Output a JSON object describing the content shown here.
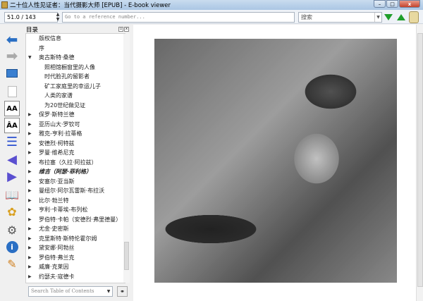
{
  "window": {
    "title": "二十位人性见证者：当代摄影大师 [EPUB] - E-book viewer",
    "minimize": "–",
    "maximize": "□",
    "close": "x"
  },
  "toolbar": {
    "page_position": "51.0 / 143",
    "reference_placeholder": "Go to a reference number...",
    "search_placeholder": "搜索"
  },
  "sidebar": {
    "icons": [
      "back-icon",
      "forward-icon",
      "view-icon",
      "copy-icon",
      "font-larger-icon",
      "font-smaller-icon",
      "toc-icon",
      "previous-page-icon",
      "next-page-icon",
      "reference-mode-icon",
      "theme-icon",
      "preferences-icon",
      "metadata-info-icon",
      "bookmark-icon"
    ]
  },
  "toc": {
    "title": "目录",
    "search_placeholder": "Search Table of Contents",
    "items": [
      {
        "label": "版权信息",
        "level": 0,
        "arrow": ""
      },
      {
        "label": "序",
        "level": 0,
        "arrow": ""
      },
      {
        "label": "奥古斯特·桑德",
        "level": 0,
        "arrow": "▼"
      },
      {
        "label": "照相馆橱窗里的人像",
        "level": 1,
        "arrow": ""
      },
      {
        "label": "时代脸孔的留影者",
        "level": 1,
        "arrow": ""
      },
      {
        "label": "矿工家庭里的幸运儿子",
        "level": 1,
        "arrow": ""
      },
      {
        "label": "人类的家谱",
        "level": 1,
        "arrow": ""
      },
      {
        "label": "为20世纪做见证",
        "level": 1,
        "arrow": ""
      },
      {
        "label": "保罗·斯特兰德",
        "level": 0,
        "arrow": "▶"
      },
      {
        "label": "亚历山大·罗钦可",
        "level": 0,
        "arrow": "▶"
      },
      {
        "label": "雅克-亨利·拉蒂格",
        "level": 0,
        "arrow": "▶"
      },
      {
        "label": "安德烈·柯特兹",
        "level": 0,
        "arrow": "▶"
      },
      {
        "label": "罗曼·维希尼克",
        "level": 0,
        "arrow": "▶"
      },
      {
        "label": "布拉塞（久拉·阿拉兹）",
        "level": 0,
        "arrow": "▶"
      },
      {
        "label": "维吉（阿瑟·菲利格）",
        "level": 0,
        "arrow": "▶",
        "current": true
      },
      {
        "label": "安塞尔·亚当斯",
        "level": 0,
        "arrow": "▶"
      },
      {
        "label": "曼纽尔·阿尔瓦雷斯·布拉沃",
        "level": 0,
        "arrow": "▶"
      },
      {
        "label": "比尔·勃兰特",
        "level": 0,
        "arrow": "▶"
      },
      {
        "label": "亨利·卡蒂埃-布列松",
        "level": 0,
        "arrow": "▶"
      },
      {
        "label": "罗伯特·卡帕（安德烈·弗里德曼）",
        "level": 0,
        "arrow": "▶"
      },
      {
        "label": "尤金·史密斯",
        "level": 0,
        "arrow": "▶"
      },
      {
        "label": "克里斯特·斯特伦霍尔姆",
        "level": 0,
        "arrow": "▶"
      },
      {
        "label": "黛安娜·阿勃丝",
        "level": 0,
        "arrow": "▶"
      },
      {
        "label": "罗伯特·弗兰克",
        "level": 0,
        "arrow": "▶"
      },
      {
        "label": "威廉·克莱因",
        "level": 0,
        "arrow": "▶"
      },
      {
        "label": "约瑟夫·寇德卡",
        "level": 0,
        "arrow": "▶"
      }
    ]
  },
  "colors": {
    "accent_green": "#1f9e2b",
    "nav_blue": "#2a6fc4",
    "nav_purple": "#5a4fd0"
  }
}
